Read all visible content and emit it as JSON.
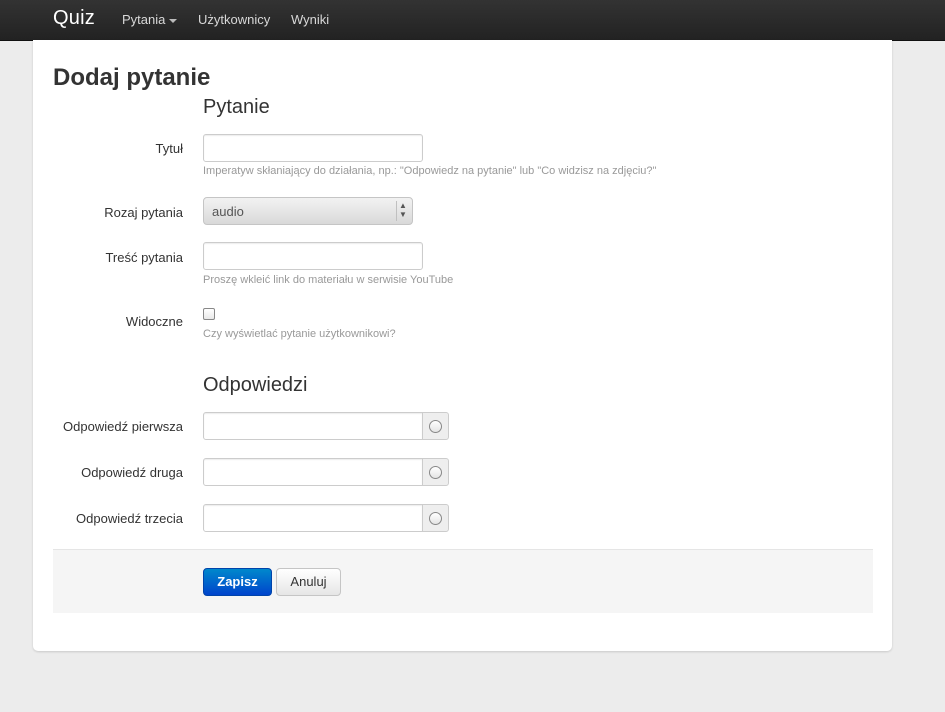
{
  "nav": {
    "brand": "Quiz",
    "items": [
      {
        "label": "Pytania",
        "has_dropdown": true
      },
      {
        "label": "Użytkownicy"
      },
      {
        "label": "Wyniki"
      }
    ]
  },
  "page": {
    "title": "Dodaj pytanie"
  },
  "question_section": {
    "legend": "Pytanie",
    "title_label": "Tytuł",
    "title_value": "",
    "title_help": "Imperatyw skłaniający do działania, np.: \"Odpowiedz na pytanie\" lub \"Co widzisz na zdjęciu?\"",
    "type_label": "Rozaj pytania",
    "type_value": "audio",
    "content_label": "Treść pytania",
    "content_value": "",
    "content_help": "Proszę wkleić link do materiału w serwisie YouTube",
    "visible_label": "Widoczne",
    "visible_checked": false,
    "visible_help": "Czy wyświetlać pytanie użytkownikowi?"
  },
  "answers_section": {
    "legend": "Odpowiedzi",
    "answers": [
      {
        "label": "Odpowiedź pierwsza",
        "value": "",
        "selected": false
      },
      {
        "label": "Odpowiedź druga",
        "value": "",
        "selected": false
      },
      {
        "label": "Odpowiedź trzecia",
        "value": "",
        "selected": false
      }
    ]
  },
  "actions": {
    "save_label": "Zapisz",
    "cancel_label": "Anuluj"
  },
  "colors": {
    "navbar": "#222222",
    "primary_button": "#0066cc",
    "background": "#ececec"
  }
}
